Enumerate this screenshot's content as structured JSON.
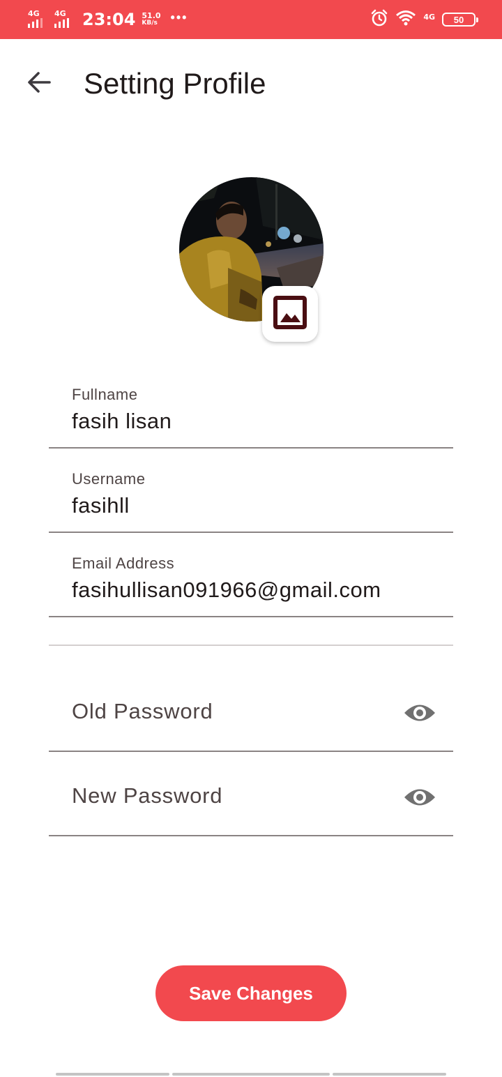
{
  "status_bar": {
    "sim1": "4G",
    "sim2": "4G",
    "time": "23:04",
    "speed_value": "51.0",
    "speed_unit": "KB/s",
    "more": "•••",
    "network_type": "4G",
    "battery": "50",
    "icons": [
      "signal-icon",
      "alarm-icon",
      "wifi-icon",
      "battery-icon"
    ]
  },
  "header": {
    "title": "Setting Profile",
    "back_icon": "arrow-back-icon"
  },
  "profile": {
    "avatar": "profile-photo",
    "change_photo_icon": "image-icon"
  },
  "form": {
    "fullname": {
      "label": "Fullname",
      "value": "fasih lisan"
    },
    "username": {
      "label": "Username",
      "value": "fasihll"
    },
    "email": {
      "label": "Email Address",
      "value": "fasihullisan091966@gmail.com"
    },
    "old_password": {
      "placeholder": "Old Password",
      "icon": "eye-icon"
    },
    "new_password": {
      "placeholder": "New Password",
      "icon": "eye-icon"
    }
  },
  "actions": {
    "save_label": "Save Changes"
  },
  "colors": {
    "accent": "#f2494e",
    "text": "#201a1a",
    "label": "#4e4444",
    "icon_dark": "#4a0e12",
    "eye_icon": "#707070"
  }
}
